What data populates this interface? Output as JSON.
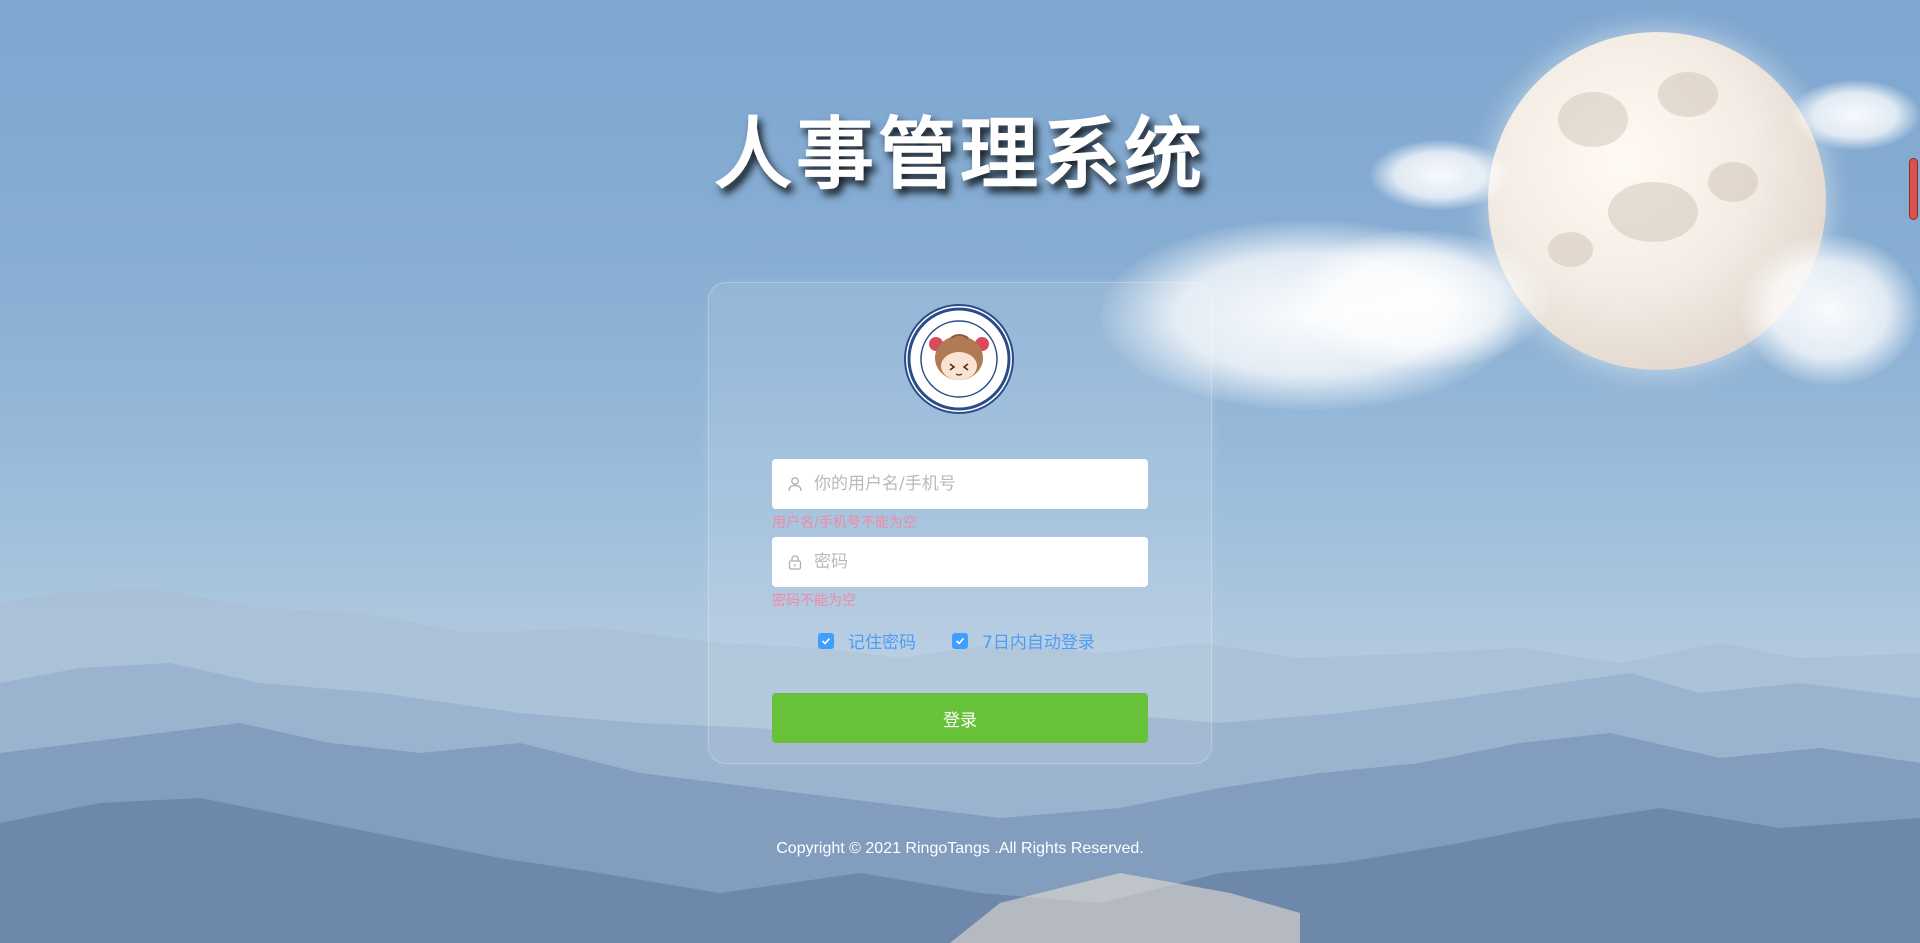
{
  "header": {
    "title": "人事管理系统"
  },
  "login": {
    "avatar": "school-mascot-avatar",
    "username": {
      "placeholder": "你的用户名/手机号",
      "value": "",
      "error": "用户名/手机号不能为空",
      "icon": "user-icon"
    },
    "password": {
      "placeholder": "密码",
      "value": "",
      "error": "密码不能为空",
      "icon": "lock-icon"
    },
    "remember": {
      "label": "记住密码",
      "checked": true
    },
    "auto_login": {
      "label": "7日内自动登录",
      "checked": true
    },
    "submit_label": "登录"
  },
  "footer": {
    "copyright": "Copyright © 2021 RingoTangs .All Rights Reserved."
  },
  "colors": {
    "primary_button": "#67c23a",
    "checkbox_accent": "#409eff",
    "error_text": "#f08aa6"
  }
}
